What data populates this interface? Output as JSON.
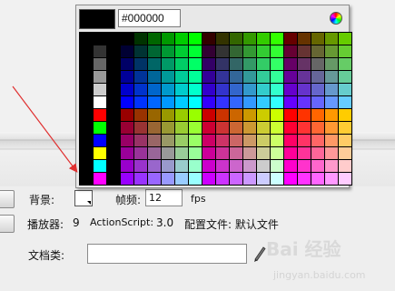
{
  "picker": {
    "hex_value": "#000000",
    "selected_color": "#000000",
    "columns": 20,
    "rows": 12
  },
  "properties": {
    "background_label": "背景:",
    "frame_rate_label": "帧频:",
    "frame_rate_value": "12",
    "fps_label": "fps",
    "player_label": "播放器:",
    "player_value": "9",
    "actionscript_label": "ActionScript:",
    "actionscript_value": "3.0",
    "profile_label": "配置文件: 默认文件",
    "doc_class_label": "文档类:"
  },
  "watermark": {
    "logo_text": "Bai 经验",
    "url": "jingyan.baidu.com"
  },
  "annotation_color": "#e03030"
}
